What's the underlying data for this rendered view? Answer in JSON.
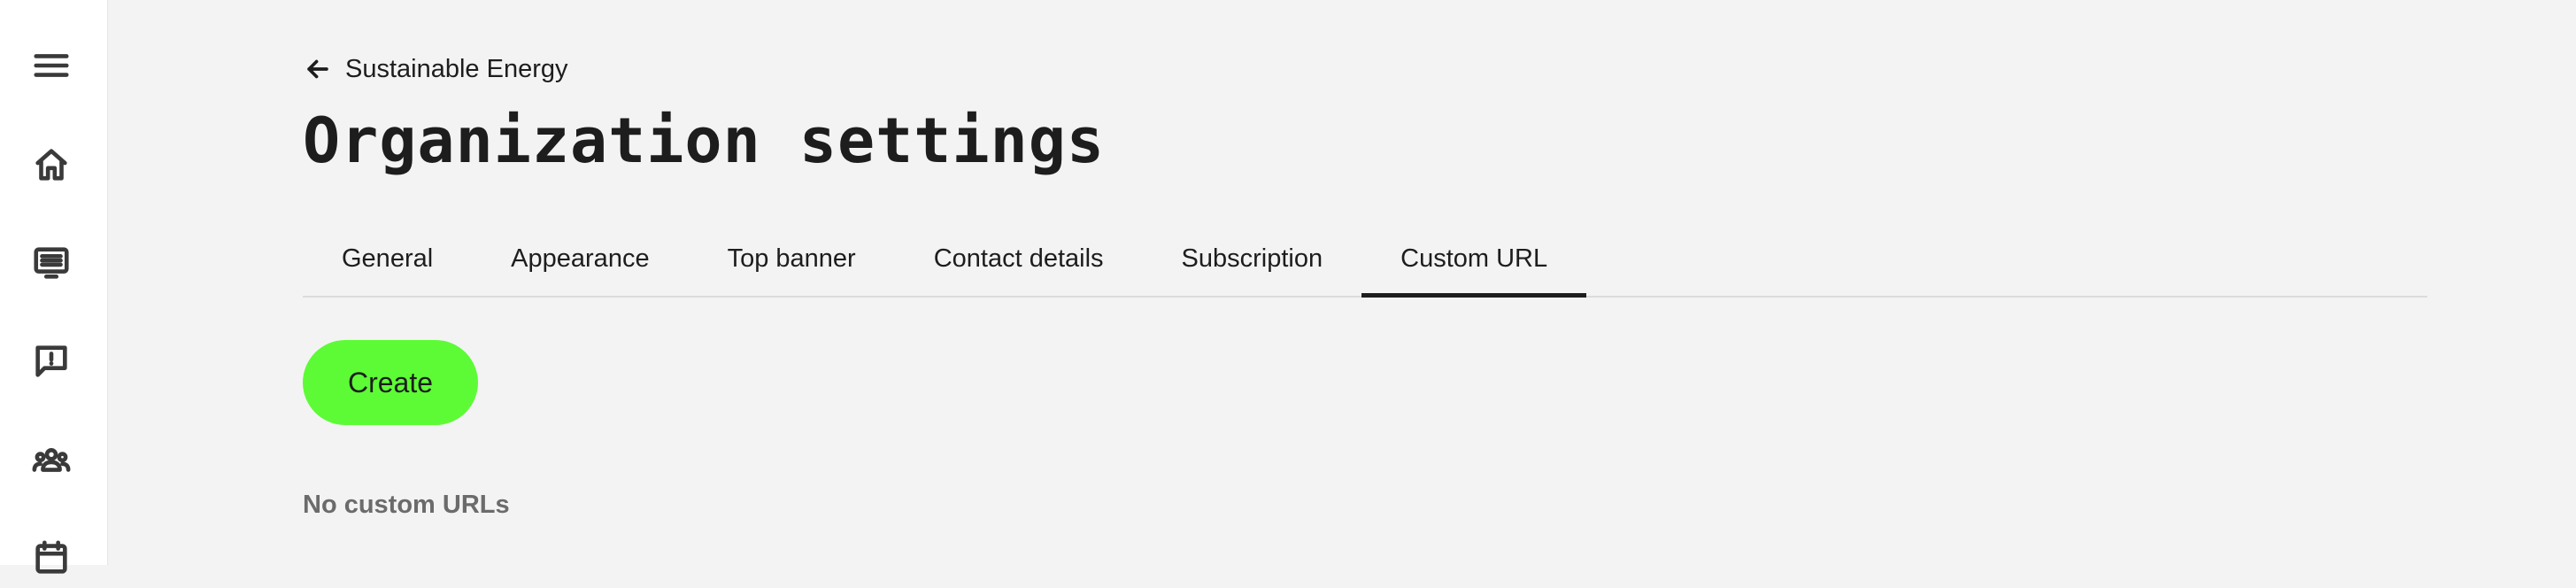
{
  "sidebar": {
    "items": [
      {
        "icon": "menu-icon"
      },
      {
        "icon": "home-icon"
      },
      {
        "icon": "monitor-list-icon"
      },
      {
        "icon": "feedback-icon"
      },
      {
        "icon": "people-icon"
      },
      {
        "icon": "calendar-icon"
      }
    ]
  },
  "breadcrumb": {
    "label": "Sustainable Energy",
    "icon": "arrow-left-icon"
  },
  "page": {
    "title": "Organization settings"
  },
  "tabs": [
    {
      "label": "General",
      "active": false
    },
    {
      "label": "Appearance",
      "active": false
    },
    {
      "label": "Top banner",
      "active": false
    },
    {
      "label": "Contact details",
      "active": false
    },
    {
      "label": "Subscription",
      "active": false
    },
    {
      "label": "Custom URL",
      "active": true
    }
  ],
  "actions": {
    "create_label": "Create"
  },
  "content": {
    "empty_message": "No custom URLs"
  },
  "colors": {
    "accent": "#5dfb36",
    "background": "#f3f3f3",
    "sidebar": "#ffffff",
    "text": "#1d1d1d",
    "muted": "#6b6b6b"
  }
}
